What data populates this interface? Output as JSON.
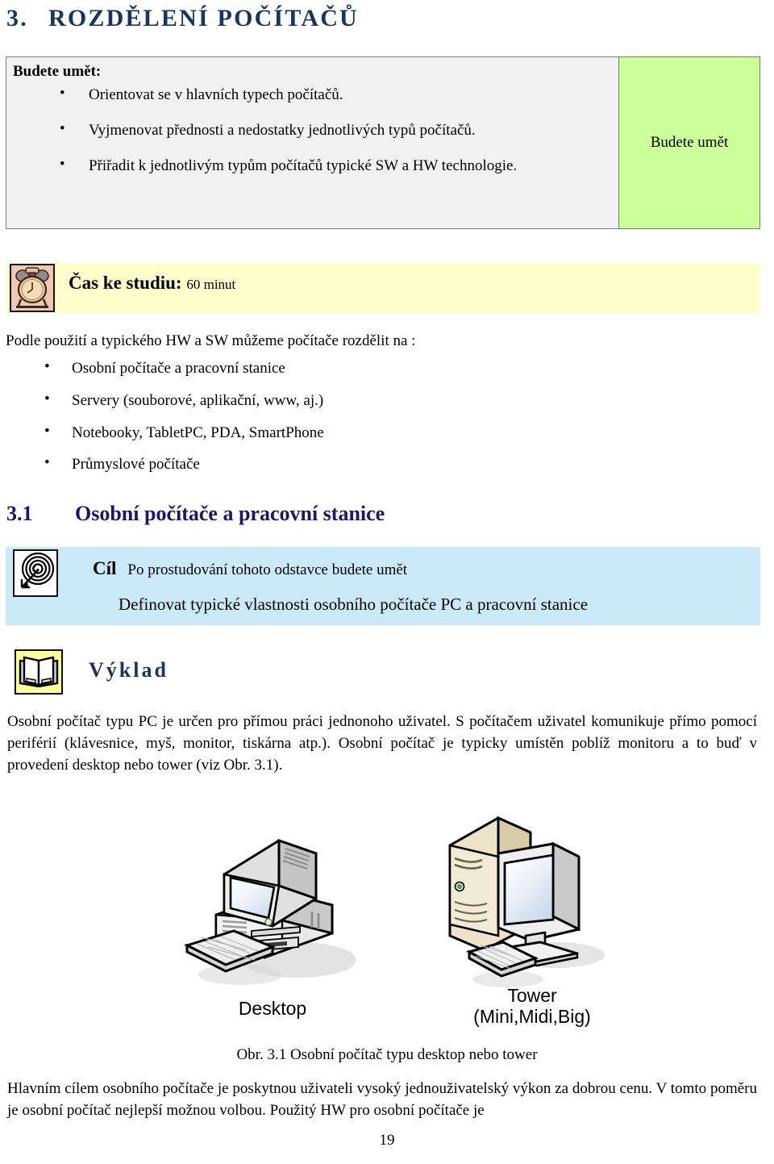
{
  "chapter": {
    "number": "3.",
    "title": "ROZDĚLENÍ POČÍTAČŮ"
  },
  "objectives": {
    "title": "Budete umět:",
    "items": [
      "Orientovat se v hlavních typech počítačů.",
      "Vyjmenovat přednosti a nedostatky jednotlivých typů počítačů.",
      "Přiřadit k jednotlivým typům počítačů typické SW a HW technologie."
    ],
    "side_label": "Budete umět",
    "side_color": "#CCFF99",
    "main_color": "#F2F2F2"
  },
  "study_time": {
    "icon": "alarm-clock-icon",
    "label": "Čas ke studiu:",
    "value": "60 minut",
    "band_color": "#FFFFCC",
    "icon_bg": "#F2C8B4"
  },
  "intro": {
    "lead": "Podle použití a typického HW a SW můžeme počítače rozdělit na :",
    "items": [
      "Osobní počítače a pracovní stanice",
      "Servery (souborové, aplikační, www, aj.)",
      "Notebooky, TabletPC, PDA, SmartPhone",
      "Průmyslové počítače"
    ]
  },
  "section": {
    "number": "3.1",
    "title": "Osobní počítače a pracovní stanice",
    "heading_color": "#17186B"
  },
  "goal": {
    "icon": "target-arrow-icon",
    "label": "Cíl",
    "subtitle": "Po prostudování tohoto odstavce budete umět",
    "text": "Definovat typické vlastnosti osobního počítače PC a pracovní stanice",
    "box_color": "#CCE9F8"
  },
  "exposition": {
    "icon": "open-book-icon",
    "label": "Výklad",
    "icon_bg": "#FFFF99",
    "label_color": "#17365D"
  },
  "body": {
    "paragraph_1": "Osobní počítač typu PC je určen pro přímou práci jednonoho uživatel. S počítačem uživatel komunikuje přímo pomocí periférií (klávesnice, myš, monitor, tiskárna atp.). Osobní počítač je typicky umístěn poblíž monitoru a to buď v provedení desktop nebo tower (viz Obr. 3.1).",
    "paragraph_2": "Hlavním cílem osobního počítače je poskytnou uživateli vysoký jednouživatelský výkon za dobrou cenu. V tomto poměru je osobní počítač nejlepší možnou volbou. Použitý HW pro osobní počítače je"
  },
  "figure": {
    "desktop_label": "Desktop",
    "tower_label_line1": "Tower",
    "tower_label_line2": "(Mini,Midi,Big)",
    "caption": "Obr. 3.1 Osobní počítač typu desktop nebo tower",
    "desktop_icon": "desktop-computer-illustration",
    "tower_icon": "tower-computer-illustration"
  },
  "page_number": "19"
}
